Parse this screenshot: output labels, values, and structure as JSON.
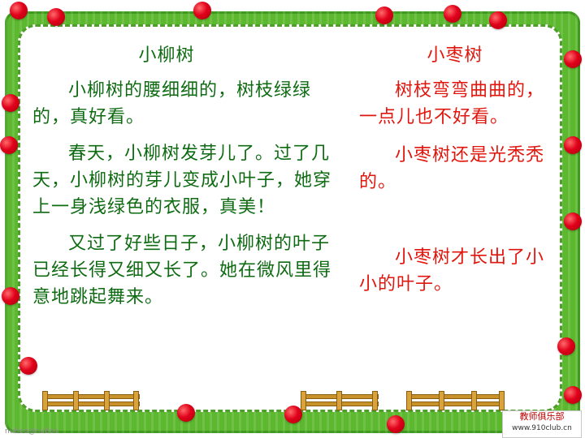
{
  "left": {
    "title": "小柳树",
    "paragraphs": [
      "小柳树的腰细细的，树枝绿绿的，真好看。",
      "春天，小柳树发芽儿了。过了几天，小柳树的芽儿变成小叶子，她穿上一身浅绿色的衣服，真美！",
      "又过了好些日子，小柳树的叶子已经长得又细又长了。她在微风里得意地跳起舞来。"
    ]
  },
  "right": {
    "title": "小枣树",
    "paragraphs": [
      "树枝弯弯曲曲的，一点儿也不好看。",
      "小枣树还是光秃秃的。",
      "小枣树才长出了小小的叶子。"
    ]
  },
  "stamp": {
    "name": "教师俱乐部",
    "url": "www.910club.cn"
  },
  "watermark": "nuBoo@nuBoo",
  "colors": {
    "frame_green": "#5cb82e",
    "left_text": "#0e6b12",
    "right_text": "#e0160d",
    "berry": "#e0001a"
  }
}
